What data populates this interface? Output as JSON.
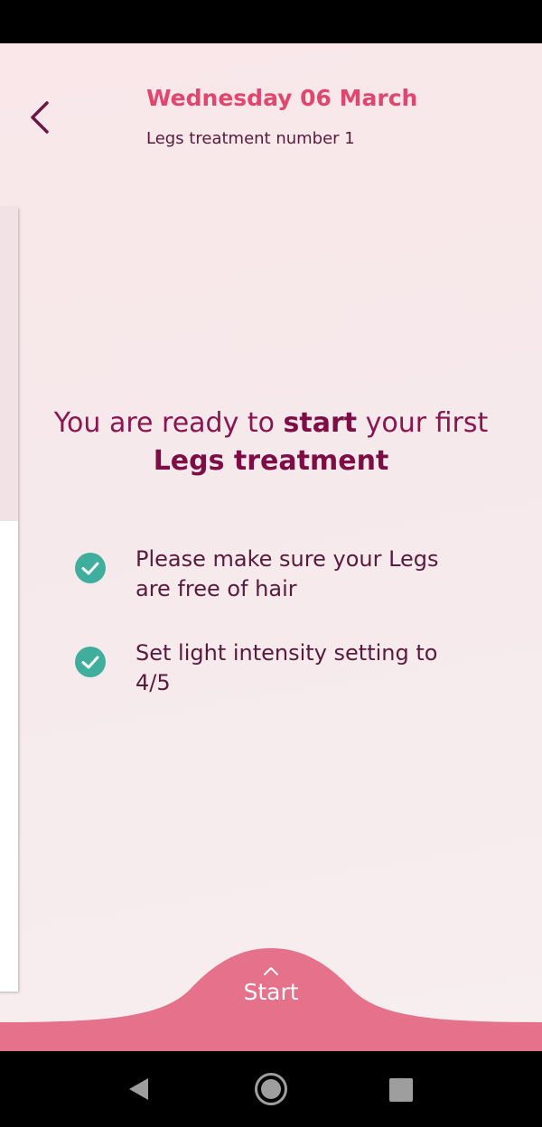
{
  "header": {
    "back_icon": "chevron-left-icon",
    "title": "Wednesday 06 March",
    "subtitle": "Legs treatment number 1"
  },
  "headline": {
    "part1": "You are ready to ",
    "bold1": "start",
    "part2": " your first ",
    "bold2": "Legs treatment"
  },
  "checklist": [
    {
      "icon": "check-circle-icon",
      "text": "Please make sure your Legs are free of hair"
    },
    {
      "icon": "check-circle-icon",
      "text": "Set light intensity setting to 4/5"
    }
  ],
  "start_button": {
    "label": "Start",
    "icon": "chevron-up-icon"
  },
  "colors": {
    "accent_pink": "#e0466e",
    "bottom_pink": "#e5718b",
    "check_teal": "#3fae9c",
    "text_plum": "#5a1a3c"
  },
  "system_nav": {
    "back": "triangle-back-icon",
    "home": "circle-home-icon",
    "recents": "square-recents-icon"
  }
}
